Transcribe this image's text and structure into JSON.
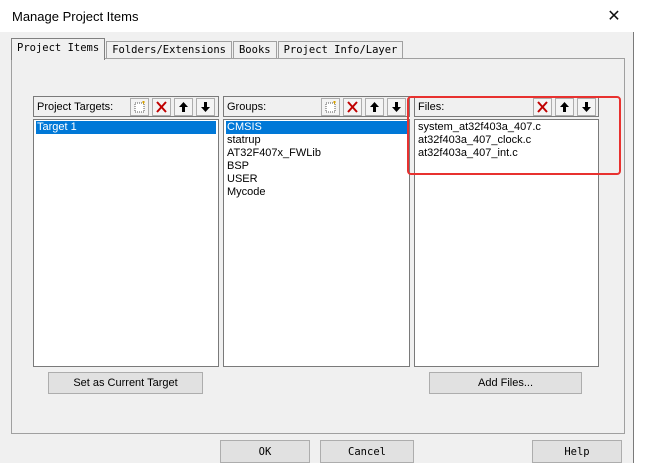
{
  "window": {
    "title": "Manage Project Items",
    "close_glyph": "✕"
  },
  "tabs": [
    {
      "label": "Project Items",
      "active": true
    },
    {
      "label": "Folders/Extensions",
      "active": false
    },
    {
      "label": "Books",
      "active": false
    },
    {
      "label": "Project Info/Layer",
      "active": false
    }
  ],
  "targets": {
    "label": "Project Targets:",
    "items": [
      "Target 1"
    ],
    "selected": "Target 1",
    "set_current_button": "Set as Current Target"
  },
  "groups": {
    "label": "Groups:",
    "items": [
      "CMSIS",
      "statrup",
      "AT32F407x_FWLib",
      "BSP",
      "USER",
      "Mycode"
    ],
    "selected": "CMSIS"
  },
  "files": {
    "label": "Files:",
    "items": [
      "system_at32f403a_407.c",
      "at32f403a_407_clock.c",
      "at32f403a_407_int.c"
    ],
    "add_button": "Add Files..."
  },
  "footer": {
    "ok": "OK",
    "cancel": "Cancel",
    "help": "Help"
  },
  "colors": {
    "selection": "#0078d7",
    "highlight_box": "#e8312f",
    "delete_icon": "#c00000"
  },
  "icons": [
    "new-icon",
    "delete-icon",
    "move-up-icon",
    "move-down-icon",
    "close-icon"
  ]
}
